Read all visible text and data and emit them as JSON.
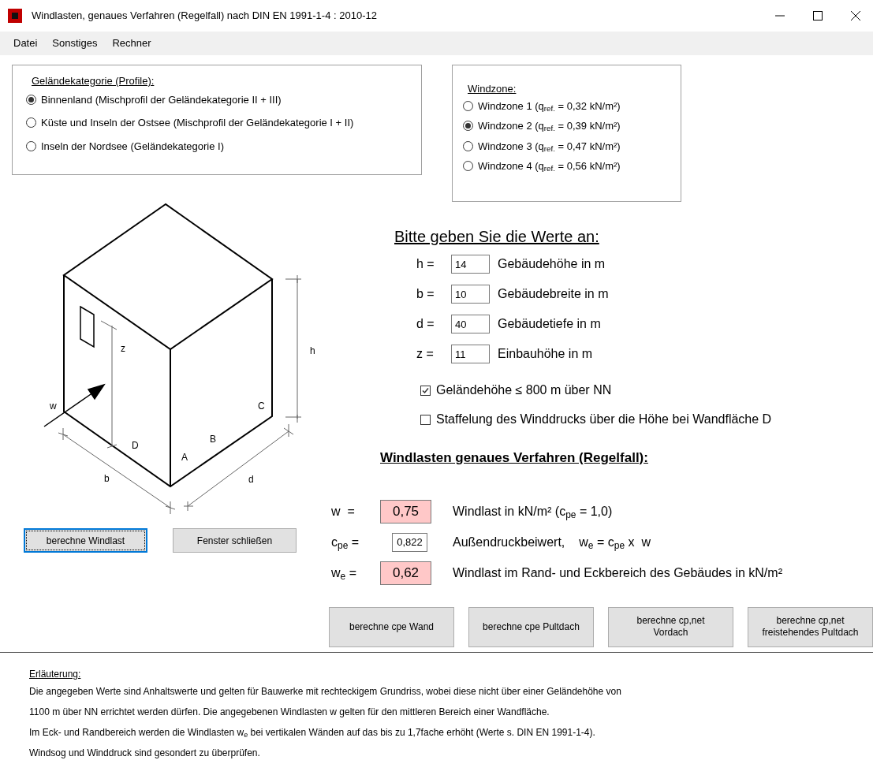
{
  "window": {
    "title": "Windlasten, genaues Verfahren (Regelfall) nach DIN EN 1991-1-4 : 2010-12"
  },
  "menu": [
    "Datei",
    "Sonstiges",
    "Rechner"
  ],
  "terrain": {
    "title": "Geländekategorie (Profile):",
    "options": [
      {
        "label": "Binnenland (Mischprofil der Geländekategorie II + III)",
        "selected": true
      },
      {
        "label": "Küste und Inseln der Ostsee (Mischprofil der Geländekategorie I + II)",
        "selected": false
      },
      {
        "label": "Inseln der Nordsee (Geländekategorie I)",
        "selected": false
      }
    ]
  },
  "windzone": {
    "title": "Windzone:",
    "options": [
      {
        "label": "Windzone 1 (q$_{ref.}$ = 0,32 kN/m²)",
        "selected": false
      },
      {
        "label": "Windzone 2 (q$_{ref.}$ = 0,39 kN/m²)",
        "selected": true
      },
      {
        "label": "Windzone 3 (q$_{ref.}$ = 0,47 kN/m²)",
        "selected": false
      },
      {
        "label": "Windzone 4 (q$_{ref.}$ = 0,56 kN/m²)",
        "selected": false
      }
    ]
  },
  "figure": {
    "labels": [
      "w",
      "z",
      "h",
      "D",
      "A",
      "B",
      "C",
      "b",
      "d"
    ]
  },
  "left_buttons": [
    {
      "label": "berechne Windlast",
      "focused": true
    },
    {
      "label": "Fenster schließen",
      "focused": false
    }
  ],
  "inputs": {
    "title": "Bitte geben Sie die Werte an:",
    "rows": [
      {
        "symbol": "h =",
        "value": "14",
        "description": "Gebäudehöhe in m"
      },
      {
        "symbol": "b =",
        "value": "10",
        "description": "Gebäudebreite in m"
      },
      {
        "symbol": "d =",
        "value": "40",
        "description": "Gebäudetiefe in m"
      },
      {
        "symbol": "z =",
        "value": "11",
        "description": "Einbauhöhe in m"
      }
    ]
  },
  "checkboxes": [
    {
      "label": "Geländehöhe ≤ 800 m über NN",
      "checked": true
    },
    {
      "label": "Staffelung des Winddrucks über die Höhe bei Wandfläche D",
      "checked": false
    }
  ],
  "results": {
    "title": "Windlasten genaues Verfahren (Regelfall):",
    "rows": [
      {
        "kind": "output",
        "symbol": "w  =",
        "value": "0,75",
        "description": "Windlast in kN/m² (c$_{pe}$ = 1,0)"
      },
      {
        "kind": "input",
        "symbol": "c$_{pe}$ =",
        "value": "0,822",
        "description": "Außendruckbeiwert,",
        "formula": "w$_{e}$ = c$_{pe}$ x  w"
      },
      {
        "kind": "output",
        "symbol": "w$_{e}$ =",
        "value": "0,62",
        "description": "Windlast im Rand- und Eckbereich des Gebäudes in kN/m²"
      }
    ]
  },
  "buttons": [
    "berechne cpe Wand",
    "berechne cpe Pultdach",
    "berechne cp,net\nVordach",
    "berechne cp,net\nfreistehendes Pultdach"
  ],
  "explanation": {
    "title": "Erläuterung:",
    "lines": [
      "Die angegeben Werte sind Anhaltswerte und gelten für Bauwerke mit rechteckigem Grundriss, wobei diese nicht über einer Geländehöhe von",
      "1100 m über NN errichtet werden dürfen. Die angegebenen Windlasten w gelten für den mittleren Bereich einer Wandfläche.",
      "Im Eck- und Randbereich werden die Windlasten w$_{e}$ bei vertikalen Wänden auf das bis zu 1,7fache erhöht (Werte s. DIN EN 1991-1-4).",
      "Windsog und Winddruck sind gesondert zu überprüfen."
    ]
  }
}
